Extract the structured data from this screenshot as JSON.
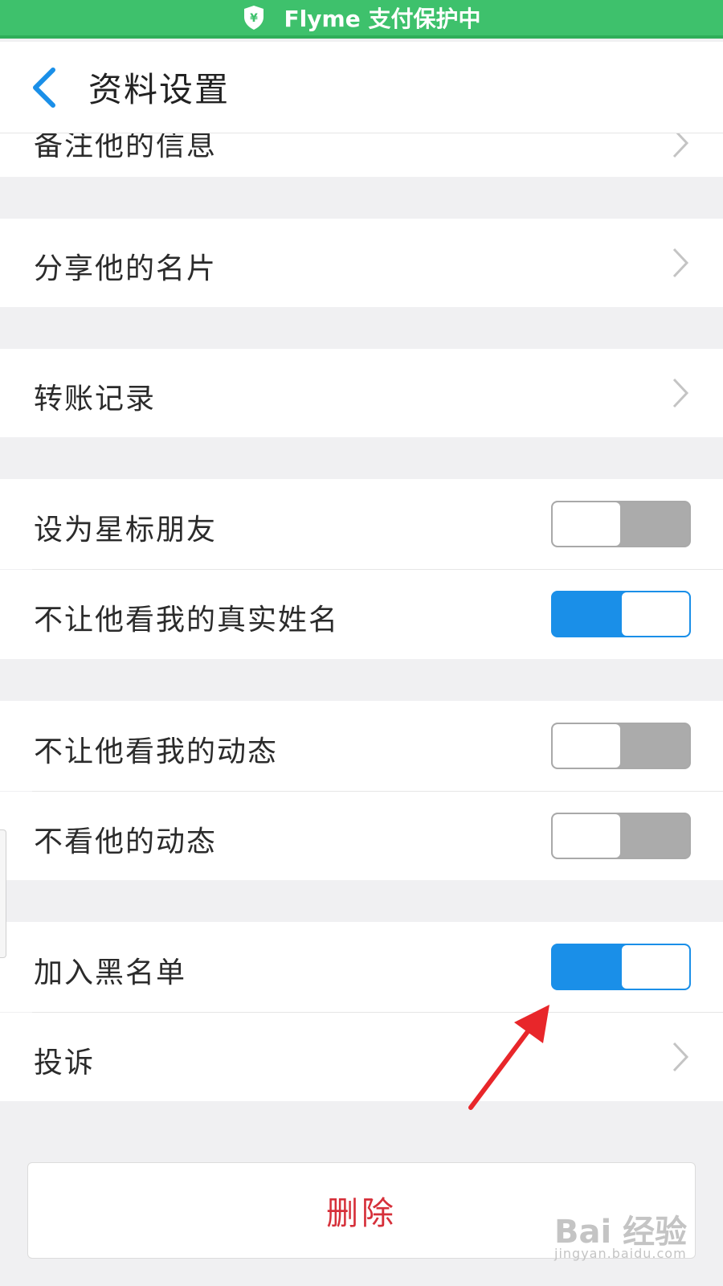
{
  "status_bar": {
    "text": "Flyme 支付保护中",
    "color": "#3ec16c",
    "icon": "shield-yen-icon"
  },
  "header": {
    "title": "资料设置",
    "back_icon": "chevron-left-icon"
  },
  "rows": {
    "remark": {
      "label": "备注他的信息"
    },
    "share_card": {
      "label": "分享他的名片"
    },
    "transfer_records": {
      "label": "转账记录"
    },
    "star_friend": {
      "label": "设为星标朋友",
      "on": false
    },
    "hide_real_name": {
      "label": "不让他看我的真实姓名",
      "on": true
    },
    "hide_my_moments": {
      "label": "不让他看我的动态",
      "on": false
    },
    "hide_his_moments": {
      "label": "不看他的动态",
      "on": false
    },
    "blacklist": {
      "label": "加入黑名单",
      "on": true
    },
    "report": {
      "label": "投诉"
    }
  },
  "delete_button": {
    "label": "删除",
    "color": "#d6303a"
  },
  "colors": {
    "toggle_on": "#1a8fe8",
    "toggle_off": "#ababab",
    "background": "#f0f0f2"
  },
  "watermark": {
    "main": "Bai 经验",
    "sub": "jingyan.baidu.com"
  }
}
